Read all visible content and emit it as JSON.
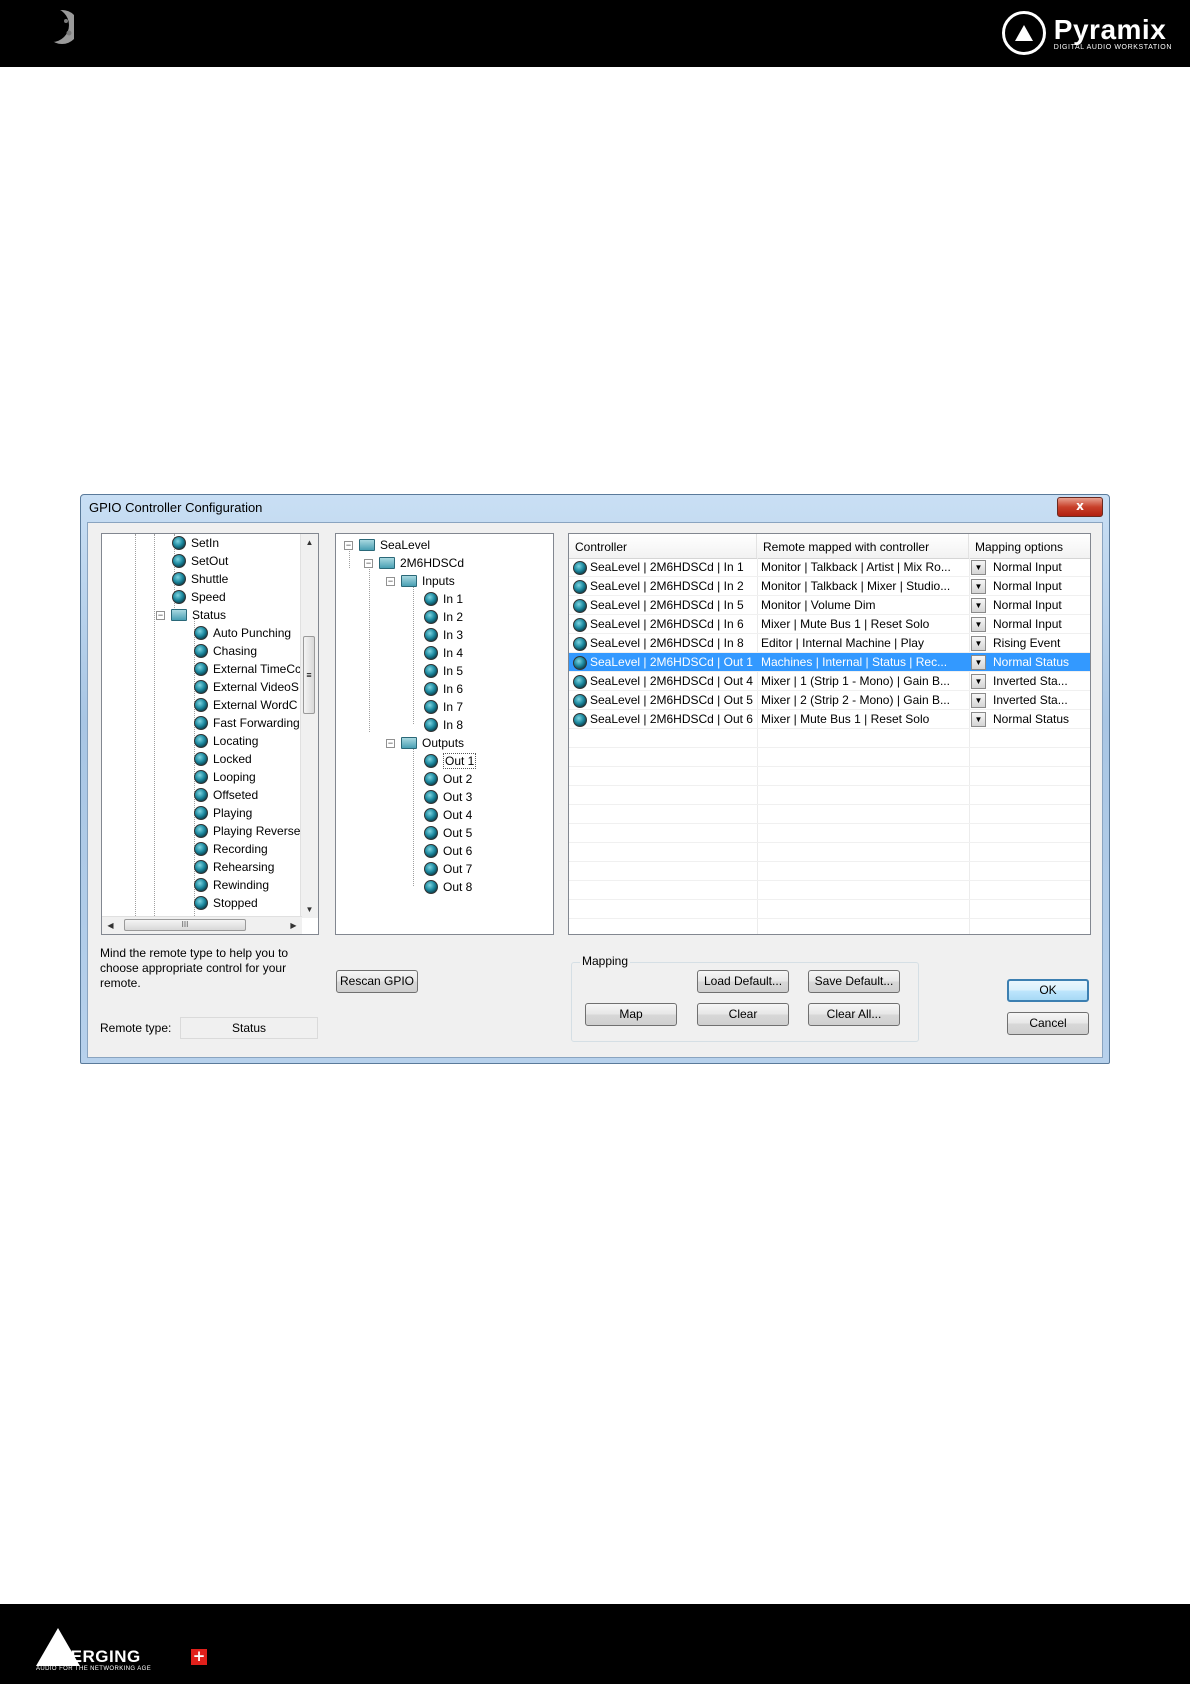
{
  "header": {
    "brand": "Pyramix",
    "brand_sub": "DIGITAL AUDIO WORKSTATION"
  },
  "footer": {
    "brand": "MERGING",
    "brand_sub": "AUDIO FOR THE NETWORKING AGE"
  },
  "dialog": {
    "title": "GPIO Controller Configuration",
    "close_label": "x",
    "left_tree": {
      "items": [
        {
          "label": "SetIn"
        },
        {
          "label": "SetOut"
        },
        {
          "label": "Shuttle"
        },
        {
          "label": "Speed"
        },
        {
          "label": "Status"
        },
        {
          "label": "Auto Punching"
        },
        {
          "label": "Chasing"
        },
        {
          "label": "External TimeCc"
        },
        {
          "label": "External VideoS"
        },
        {
          "label": "External WordC"
        },
        {
          "label": "Fast Forwarding"
        },
        {
          "label": "Locating"
        },
        {
          "label": "Locked"
        },
        {
          "label": "Looping"
        },
        {
          "label": "Offseted"
        },
        {
          "label": "Playing"
        },
        {
          "label": "Playing Reverse"
        },
        {
          "label": "Recording"
        },
        {
          "label": "Rehearsing"
        },
        {
          "label": "Rewinding"
        },
        {
          "label": "Stopped"
        }
      ],
      "hscroll_grip": "III",
      "vscroll_grip": "≡"
    },
    "middle_tree": {
      "root": "SeaLevel",
      "device": "2M6HDSCd",
      "inputs_label": "Inputs",
      "inputs": [
        "In 1",
        "In 2",
        "In 3",
        "In 4",
        "In 5",
        "In 6",
        "In 7",
        "In 8"
      ],
      "outputs_label": "Outputs",
      "outputs": [
        "Out 1",
        "Out 2",
        "Out 3",
        "Out 4",
        "Out 5",
        "Out 6",
        "Out 7",
        "Out 8"
      ]
    },
    "grid": {
      "columns": [
        "Controller",
        "Remote mapped with controller",
        "Mapping options"
      ],
      "rows": [
        {
          "controller": "SeaLevel | 2M6HDSCd | In 1",
          "remote": "Monitor | Talkback | Artist | Mix Ro...",
          "option": "Normal Input"
        },
        {
          "controller": "SeaLevel | 2M6HDSCd | In 2",
          "remote": "Monitor | Talkback | Mixer | Studio...",
          "option": "Normal Input"
        },
        {
          "controller": "SeaLevel | 2M6HDSCd | In 5",
          "remote": "Monitor | Volume Dim",
          "option": "Normal Input"
        },
        {
          "controller": "SeaLevel | 2M6HDSCd | In 6",
          "remote": "Mixer | Mute Bus 1 | Reset Solo",
          "option": "Normal Input"
        },
        {
          "controller": "SeaLevel | 2M6HDSCd | In 8",
          "remote": "Editor | Internal Machine | Play",
          "option": "Rising Event"
        },
        {
          "controller": "SeaLevel | 2M6HDSCd | Out 1",
          "remote": "Machines | Internal | Status | Rec...",
          "option": "Normal Status"
        },
        {
          "controller": "SeaLevel | 2M6HDSCd | Out 4",
          "remote": "Mixer | 1 (Strip 1 - Mono) | Gain B...",
          "option": "Inverted Sta..."
        },
        {
          "controller": "SeaLevel | 2M6HDSCd | Out 5",
          "remote": "Mixer | 2 (Strip 2 - Mono) | Gain B...",
          "option": "Inverted Sta..."
        },
        {
          "controller": "SeaLevel | 2M6HDSCd | Out 6",
          "remote": "Mixer | Mute Bus 1 | Reset Solo",
          "option": "Normal Status"
        }
      ],
      "selected_index": 5
    },
    "hint_text": "Mind the remote type to help you to choose appropriate control for your remote.",
    "remote_type_label": "Remote type:",
    "remote_type_value": "Status",
    "rescan_label": "Rescan GPIO",
    "mapping_group_label": "Mapping",
    "load_default_label": "Load Default...",
    "save_default_label": "Save Default...",
    "map_label": "Map",
    "clear_label": "Clear",
    "clear_all_label": "Clear All...",
    "ok_label": "OK",
    "cancel_label": "Cancel"
  },
  "colors": {
    "selection": "#3399ff",
    "topbar": "#000000",
    "merging_red": "#e0201b"
  }
}
